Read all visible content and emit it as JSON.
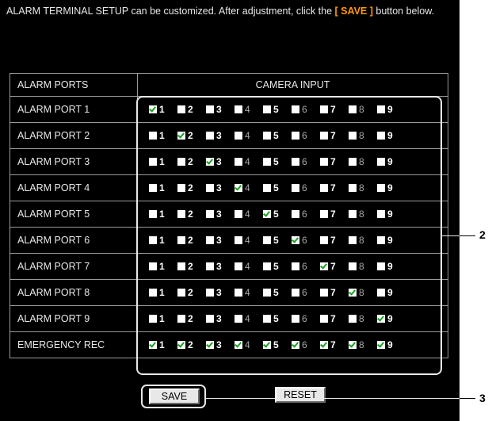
{
  "intro": {
    "text_before": "ALARM TERMINAL SETUP can be customized. After adjustment, click the ",
    "save_highlight": "[ SAVE ]",
    "text_after": " button below."
  },
  "table": {
    "header_ports": "ALARM PORTS",
    "header_cameras": "CAMERA INPUT"
  },
  "cameras": [
    {
      "label": "1",
      "dim": false
    },
    {
      "label": "2",
      "dim": false
    },
    {
      "label": "3",
      "dim": false
    },
    {
      "label": "4",
      "dim": true
    },
    {
      "label": "5",
      "dim": false
    },
    {
      "label": "6",
      "dim": true
    },
    {
      "label": "7",
      "dim": false
    },
    {
      "label": "8",
      "dim": true
    },
    {
      "label": "9",
      "dim": false
    }
  ],
  "rows": [
    {
      "label": "ALARM PORT 1",
      "checked": [
        1,
        0,
        0,
        0,
        0,
        0,
        0,
        0,
        0
      ]
    },
    {
      "label": "ALARM PORT 2",
      "checked": [
        0,
        1,
        0,
        0,
        0,
        0,
        0,
        0,
        0
      ]
    },
    {
      "label": "ALARM PORT 3",
      "checked": [
        0,
        0,
        1,
        0,
        0,
        0,
        0,
        0,
        0
      ]
    },
    {
      "label": "ALARM PORT 4",
      "checked": [
        0,
        0,
        0,
        1,
        0,
        0,
        0,
        0,
        0
      ]
    },
    {
      "label": "ALARM PORT 5",
      "checked": [
        0,
        0,
        0,
        0,
        1,
        0,
        0,
        0,
        0
      ]
    },
    {
      "label": "ALARM PORT 6",
      "checked": [
        0,
        0,
        0,
        0,
        0,
        1,
        0,
        0,
        0
      ]
    },
    {
      "label": "ALARM PORT 7",
      "checked": [
        0,
        0,
        0,
        0,
        0,
        0,
        1,
        0,
        0
      ]
    },
    {
      "label": "ALARM PORT 8",
      "checked": [
        0,
        0,
        0,
        0,
        0,
        0,
        0,
        1,
        0
      ]
    },
    {
      "label": "ALARM PORT 9",
      "checked": [
        0,
        0,
        0,
        0,
        0,
        0,
        0,
        0,
        1
      ]
    },
    {
      "label": "EMERGENCY REC",
      "checked": [
        1,
        1,
        1,
        1,
        1,
        1,
        1,
        1,
        1
      ]
    }
  ],
  "buttons": {
    "save": "SAVE",
    "reset": "RESET"
  },
  "callouts": {
    "camera_area": "2",
    "save_button": "3"
  },
  "colors": {
    "background": "#000000",
    "highlight": "#ff9a00",
    "checkmark": "#18a020"
  }
}
